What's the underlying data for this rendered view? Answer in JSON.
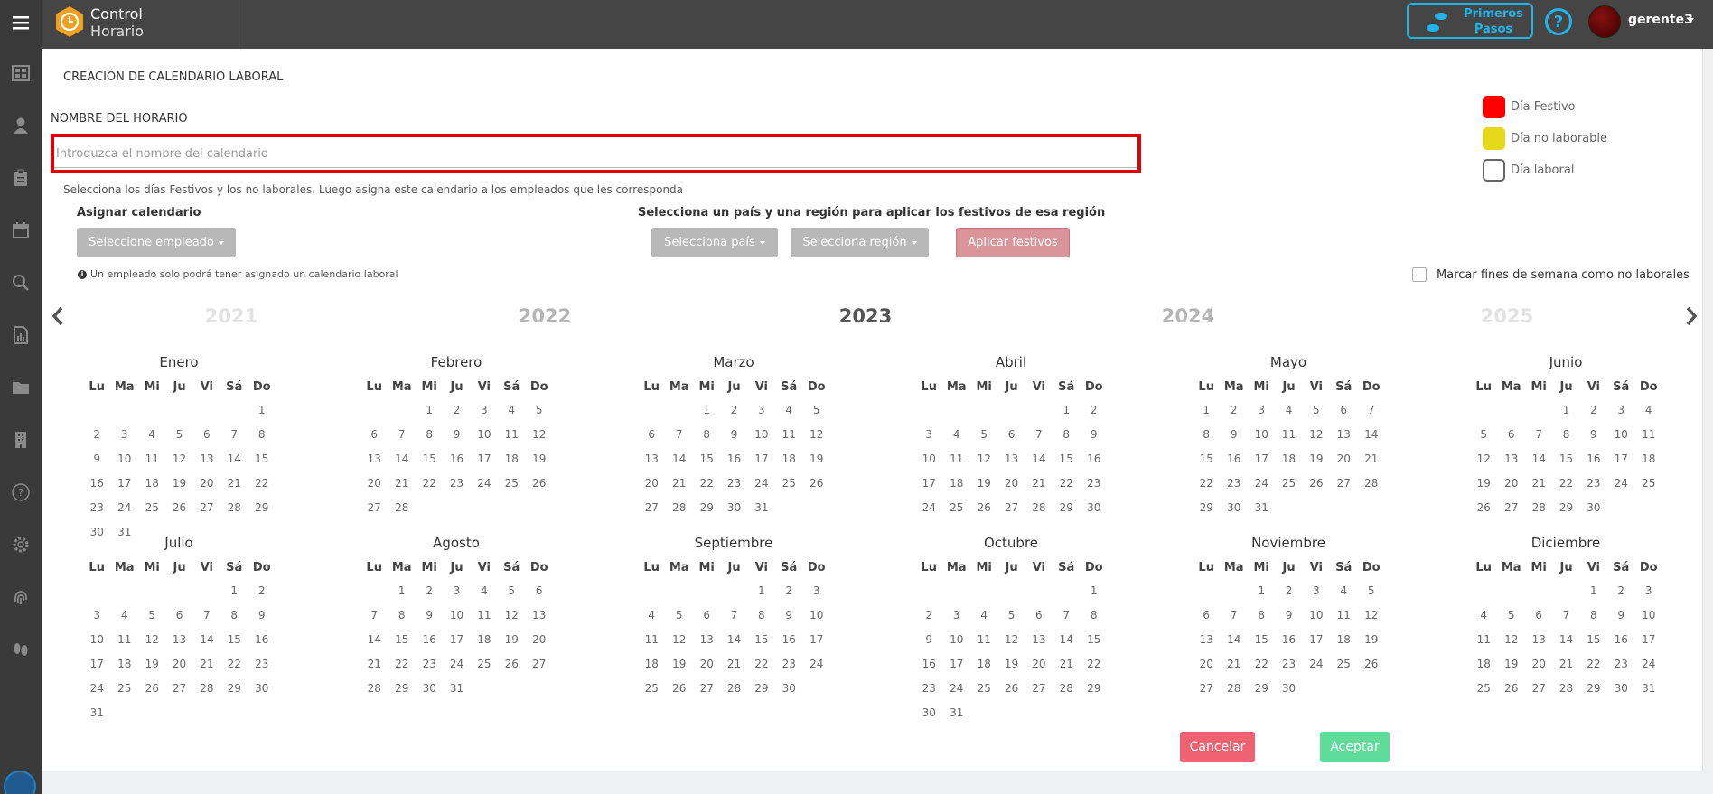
{
  "app": {
    "brand_line1": "Control",
    "brand_line2": "Horario"
  },
  "topbar": {
    "primeros_pasos": "Primeros Pasos",
    "help_symbol": "?",
    "user": "gerente3"
  },
  "sidebar": {
    "icons": [
      "menu-icon",
      "dashboard-icon",
      "user-icon",
      "clipboard-icon",
      "calendar-icon",
      "search-icon",
      "report-icon",
      "folder-icon",
      "building-icon",
      "help-circle-icon",
      "gear-icon",
      "fingerprint-icon",
      "footprints-icon"
    ]
  },
  "form": {
    "title": "CREACIÓN DE CALENDARIO LABORAL",
    "name_label": "NOMBRE DEL HORARIO",
    "name_placeholder": "Introduzca el nombre del calendario",
    "name_value": "",
    "help_text": "Selecciona los días Festivos y los no laborales. Luego asigna este calendario a los empleados que les corresponda",
    "assign_label": "Asignar calendario",
    "employee_button": "Seleccione empleado",
    "note_icon": "i",
    "note": "Un empleado solo podrá tener asignado un calendario laboral",
    "region_label": "Selecciona un país y una región para aplicar los festivos de esa región",
    "country_button": "Selecciona país",
    "region_button": "Selecciona región",
    "apply_button": "Aplicar festivos",
    "weekend_label": "Marcar fines de semana como no laborales",
    "weekend_checked": false,
    "cancel_button": "Cancelar",
    "accept_button": "Aceptar"
  },
  "legend": [
    {
      "label": "Día Festivo",
      "color": "#ff0000"
    },
    {
      "label": "Día no laborable",
      "color": "#e8d81c"
    },
    {
      "label": "Día laboral",
      "color": "#ffffff"
    }
  ],
  "years": [
    "2021",
    "2022",
    "2023",
    "2024",
    "2025"
  ],
  "selected_year": "2023",
  "weekdays": [
    "Lu",
    "Ma",
    "Mi",
    "Ju",
    "Vi",
    "Sá",
    "Do"
  ],
  "months": [
    {
      "name": "Enero",
      "offset": 6,
      "days": 31
    },
    {
      "name": "Febrero",
      "offset": 2,
      "days": 28
    },
    {
      "name": "Marzo",
      "offset": 2,
      "days": 31
    },
    {
      "name": "Abril",
      "offset": 5,
      "days": 30
    },
    {
      "name": "Mayo",
      "offset": 0,
      "days": 31
    },
    {
      "name": "Junio",
      "offset": 3,
      "days": 30
    },
    {
      "name": "Julio",
      "offset": 5,
      "days": 31
    },
    {
      "name": "Agosto",
      "offset": 1,
      "days": 31
    },
    {
      "name": "Septiembre",
      "offset": 4,
      "days": 30
    },
    {
      "name": "Octubre",
      "offset": 6,
      "days": 31
    },
    {
      "name": "Noviembre",
      "offset": 2,
      "days": 30
    },
    {
      "name": "Diciembre",
      "offset": 4,
      "days": 31
    }
  ]
}
